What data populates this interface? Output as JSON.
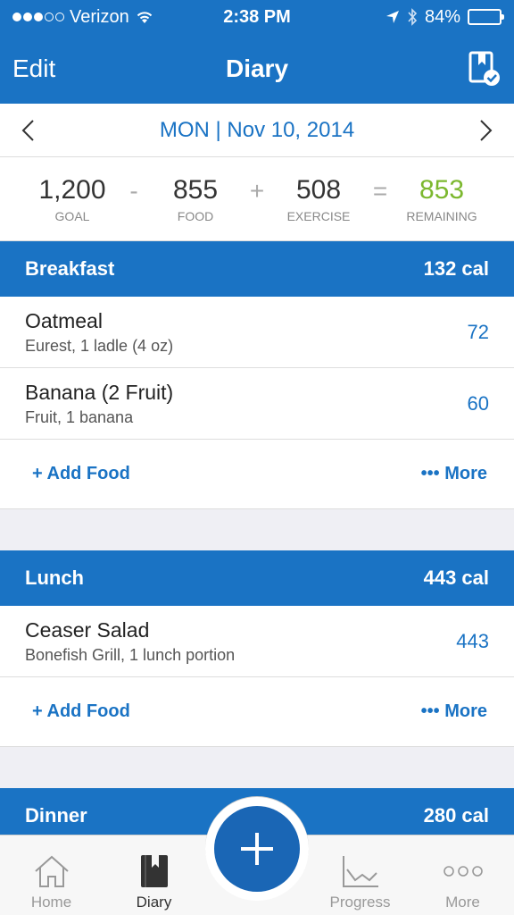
{
  "status": {
    "carrier": "Verizon",
    "time": "2:38 PM",
    "battery": "84%",
    "battery_level": 0.84
  },
  "nav": {
    "edit": "Edit",
    "title": "Diary"
  },
  "date": "MON | Nov 10, 2014",
  "calc": {
    "goal": "1,200",
    "goal_label": "GOAL",
    "minus": "-",
    "food": "855",
    "food_label": "FOOD",
    "plus": "+",
    "exercise": "508",
    "exercise_label": "EXERCISE",
    "equals": "=",
    "remaining": "853",
    "remaining_label": "REMAINING"
  },
  "breakfast": {
    "title": "Breakfast",
    "cal": "132 cal",
    "items": [
      {
        "name": "Oatmeal",
        "detail": "Eurest, 1 ladle (4 oz)",
        "cal": "72"
      },
      {
        "name": "Banana (2 Fruit)",
        "detail": "Fruit, 1 banana",
        "cal": "60"
      }
    ],
    "add": "+ Add Food",
    "more": "••• More"
  },
  "lunch": {
    "title": "Lunch",
    "cal": "443 cal",
    "items": [
      {
        "name": "Ceaser Salad",
        "detail": "Bonefish Grill, 1 lunch portion",
        "cal": "443"
      }
    ],
    "add": "+ Add Food",
    "more": "••• More"
  },
  "dinner": {
    "title": "Dinner",
    "cal": "280 cal"
  },
  "tabs": {
    "home": "Home",
    "diary": "Diary",
    "progress": "Progress",
    "more": "More"
  },
  "colors": {
    "brand": "#1a73c4",
    "remaining": "#7cb82f"
  }
}
